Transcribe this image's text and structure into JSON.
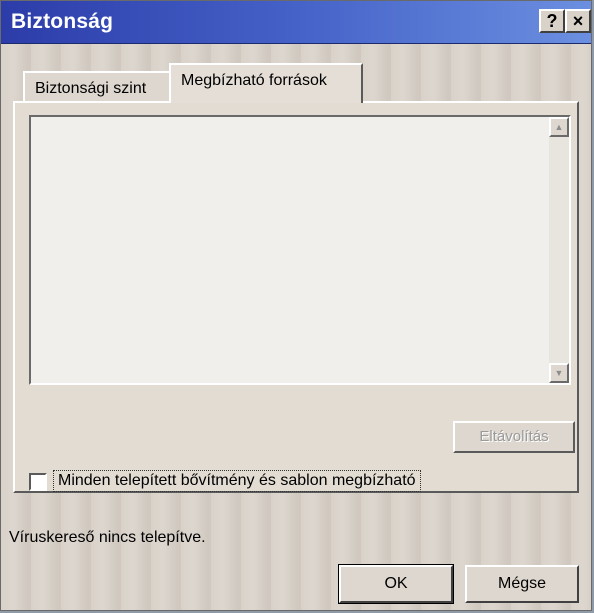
{
  "window": {
    "title": "Biztonság",
    "help_button": "?",
    "close_button": "×"
  },
  "tabs": [
    {
      "label": "Biztonsági szint",
      "active": false
    },
    {
      "label": "Megbízható források",
      "active": true
    }
  ],
  "trusted_sources": {
    "items": [],
    "scroll_up": "▲",
    "scroll_down": "▼",
    "remove_label": "Eltávolítás"
  },
  "trust_all_checkbox": {
    "label": "Minden telepített bővítmény és sablon megbízható",
    "checked": false
  },
  "status": {
    "text": "Víruskereső nincs telepítve."
  },
  "buttons": {
    "ok": "OK",
    "cancel": "Mégse"
  },
  "colors": {
    "title_gradient_start": "#2c3ca9",
    "title_gradient_end": "#6b8fe0",
    "face": "#ddd7cf",
    "disabled_text": "#9a9a9a"
  }
}
